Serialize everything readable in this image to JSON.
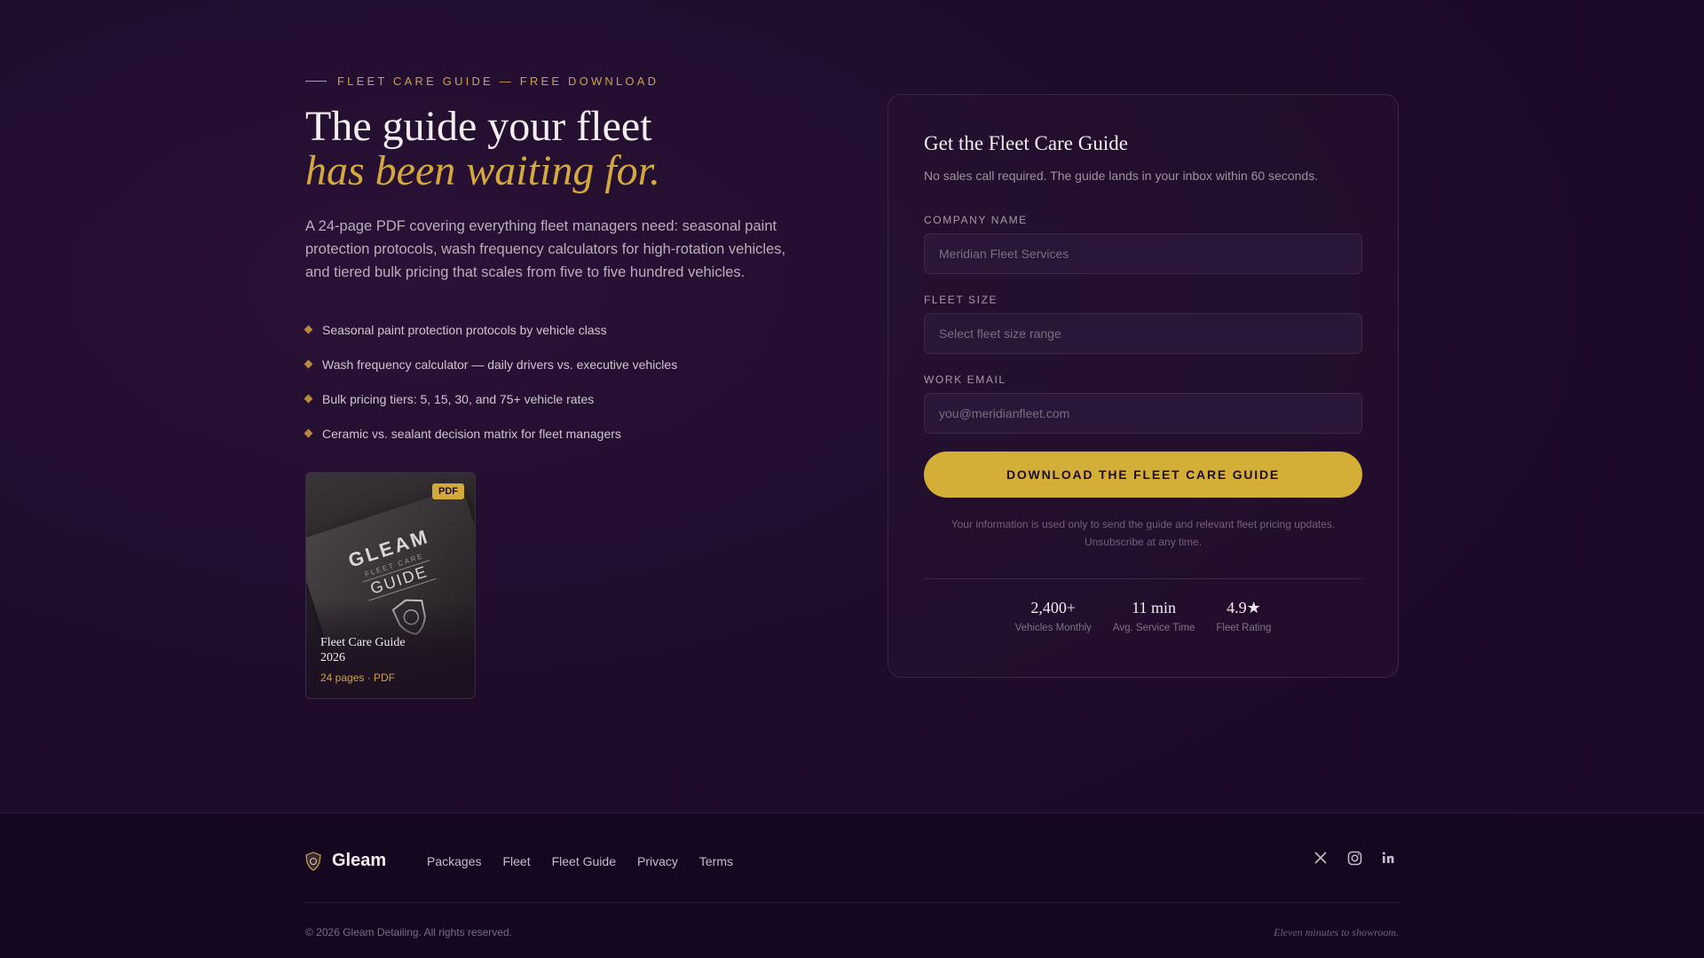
{
  "hero": {
    "eyebrow": "FLEET CARE GUIDE — FREE DOWNLOAD",
    "headline_line1": "The guide your fleet",
    "headline_line2": "has been waiting for.",
    "lede": "A 24-page PDF covering everything fleet managers need: seasonal paint protection protocols, wash frequency calculators for high-rotation vehicles, and tiered bulk pricing that scales from five to five hundred vehicles.",
    "bullets": [
      "Seasonal paint protection protocols by vehicle class",
      "Wash frequency calculator — daily drivers vs. executive vehicles",
      "Bulk pricing tiers: 5, 15, 30, and 75+ vehicle rates",
      "Ceramic vs. sealant decision matrix for fleet managers"
    ],
    "book": {
      "badge": "PDF",
      "cover_brand": "GLEAM",
      "cover_sub": "FLEET CARE",
      "cover_guide": "GUIDE",
      "title": "Fleet Care Guide 2026",
      "meta": "24 pages · PDF"
    }
  },
  "form": {
    "title": "Get the Fleet Care Guide",
    "subtitle": "No sales call required. The guide lands in your inbox within 60 seconds.",
    "company_label": "COMPANY NAME",
    "company_placeholder": "Meridian Fleet Services",
    "fleet_label": "FLEET SIZE",
    "fleet_placeholder": "Select fleet size range",
    "email_label": "WORK EMAIL",
    "email_placeholder": "you@meridianfleet.com",
    "cta": "DOWNLOAD THE FLEET CARE GUIDE",
    "disclaimer_line1": "Your information is used only to send the guide and relevant fleet pricing updates.",
    "disclaimer_line2": "Unsubscribe at any time.",
    "stats": [
      {
        "value": "2,400+",
        "label": "Vehicles Monthly"
      },
      {
        "value": "11 min",
        "label": "Avg. Service Time"
      },
      {
        "value": "4.9★",
        "label": "Fleet Rating"
      }
    ]
  },
  "footer": {
    "brand": "Gleam",
    "nav": [
      "Packages",
      "Fleet",
      "Fleet Guide",
      "Privacy",
      "Terms"
    ],
    "social": [
      "x-icon",
      "instagram-icon",
      "linkedin-icon"
    ],
    "copyright": "© 2026 Gleam Detailing. All rights reserved.",
    "tagline": "Eleven minutes to showroom."
  },
  "colors": {
    "background": "#1e0c2a",
    "accent_gold": "#d4af37",
    "footer_bg": "#150720"
  }
}
